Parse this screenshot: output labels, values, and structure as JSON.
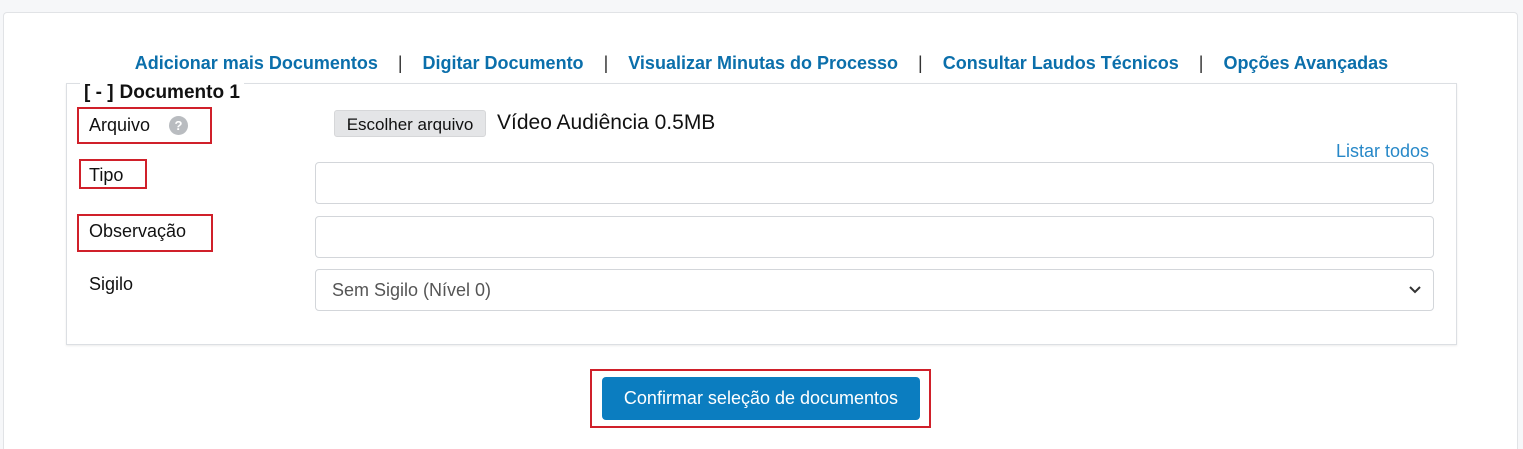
{
  "nav": {
    "items": [
      {
        "label": "Adicionar mais Documentos"
      },
      {
        "label": "Digitar Documento"
      },
      {
        "label": "Visualizar Minutas do Processo"
      },
      {
        "label": "Consultar Laudos Técnicos"
      },
      {
        "label": "Opções Avançadas"
      }
    ],
    "separator": "|"
  },
  "document": {
    "toggle": "[ - ]",
    "title": "Documento 1",
    "fields": {
      "arquivo_label": "Arquivo",
      "help_icon": "?",
      "file_button_label": "Escolher arquivo",
      "file_name": "Vídeo Audiência 0.5MB",
      "list_all_link": "Listar todos",
      "tipo_label": "Tipo",
      "tipo_value": "",
      "observacao_label": "Observação",
      "observacao_value": "",
      "sigilo_label": "Sigilo",
      "sigilo_selected": "Sem Sigilo (Nível 0)"
    }
  },
  "confirm_button_label": "Confirmar seleção de documentos",
  "colors": {
    "link": "#0b6fab",
    "primary_button": "#0b7dc0",
    "highlight_box": "#d0202a"
  },
  "icons": {
    "help": "question-circle-icon",
    "select_arrow": "chevron-down-icon"
  }
}
